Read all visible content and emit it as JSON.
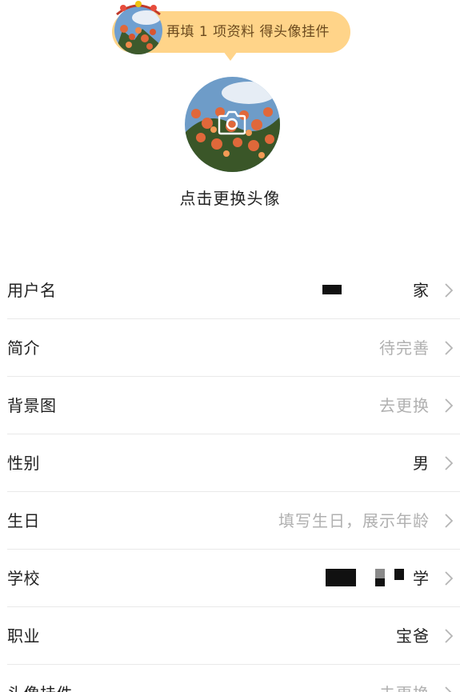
{
  "banner": {
    "text": "再填 1 项资料 得头像挂件"
  },
  "avatar": {
    "caption": "点击更换头像"
  },
  "profile_rows": [
    {
      "label": "用户名",
      "value": "家",
      "muted": false
    },
    {
      "label": "简介",
      "value": "待完善",
      "muted": true
    },
    {
      "label": "背景图",
      "value": "去更换",
      "muted": true
    },
    {
      "label": "性别",
      "value": "男",
      "muted": false
    },
    {
      "label": "生日",
      "value": "填写生日，展示年龄",
      "muted": true
    },
    {
      "label": "学校",
      "value": "学",
      "muted": false
    },
    {
      "label": "职业",
      "value": "宝爸",
      "muted": false
    },
    {
      "label": "头像挂件",
      "value": "去更换",
      "muted": true
    }
  ],
  "colors": {
    "banner_bg": "#ffd489",
    "banner_text": "#6b4a1e",
    "text_primary": "#222222",
    "text_muted": "#b0b0b0",
    "divider": "#e9e9e9"
  }
}
